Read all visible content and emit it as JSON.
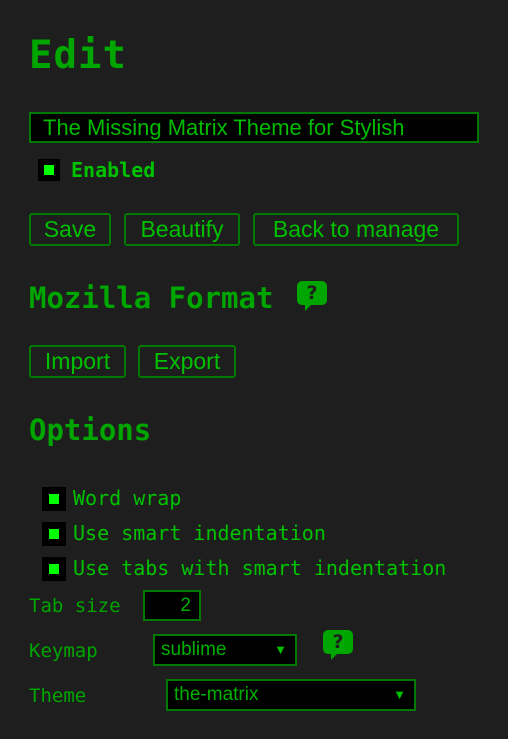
{
  "page": {
    "title": "Edit"
  },
  "style_name": {
    "value": "The Missing Matrix Theme for Stylish"
  },
  "enabled": {
    "label": "Enabled",
    "checked": true
  },
  "actions": {
    "save": "Save",
    "beautify": "Beautify",
    "back": "Back to manage"
  },
  "mozilla": {
    "heading": "Mozilla Format",
    "help_icon": "?",
    "import": "Import",
    "export": "Export"
  },
  "options": {
    "heading": "Options",
    "word_wrap": {
      "label": "Word wrap",
      "checked": true
    },
    "smart_indent": {
      "label": "Use smart indentation",
      "checked": true
    },
    "tabs_smart_indent": {
      "label": "Use tabs with smart indentation",
      "checked": true
    },
    "tab_size": {
      "label": "Tab size",
      "value": "2"
    },
    "keymap": {
      "label": "Keymap",
      "selected": "sublime",
      "help_icon": "?"
    },
    "theme": {
      "label": "Theme",
      "selected": "the-matrix"
    }
  },
  "colors": {
    "accent": "#00c000",
    "background": "#1e1e1e",
    "checkbox_mark": "#00ff00"
  },
  "icons": {
    "dropdown": "dropdown-arrow-icon",
    "help": "help-bubble-icon"
  }
}
